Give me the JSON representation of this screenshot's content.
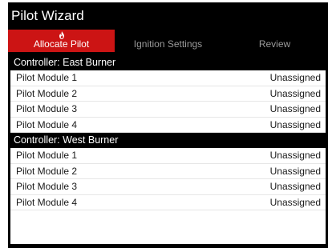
{
  "window": {
    "title": "Pilot Wizard"
  },
  "tabs": [
    {
      "label": "Allocate Pilot",
      "icon": "flame-icon",
      "active": true
    },
    {
      "label": "Ignition Settings",
      "active": false
    },
    {
      "label": "Review",
      "active": false
    }
  ],
  "colors": {
    "accent": "#cc1414",
    "background": "#000000",
    "inactive_tab_text": "#9a9a9a"
  },
  "controllers": [
    {
      "header": "Controller: East Burner",
      "modules": [
        {
          "name": "Pilot Module 1",
          "status": "Unassigned"
        },
        {
          "name": "Pilot Module 2",
          "status": "Unassigned"
        },
        {
          "name": "Pilot Module 3",
          "status": "Unassigned"
        },
        {
          "name": "Pilot Module 4",
          "status": "Unassigned"
        }
      ]
    },
    {
      "header": "Controller: West Burner",
      "modules": [
        {
          "name": "Pilot Module 1",
          "status": "Unassigned"
        },
        {
          "name": "Pilot Module 2",
          "status": "Unassigned"
        },
        {
          "name": "Pilot Module 3",
          "status": "Unassigned"
        },
        {
          "name": "Pilot Module 4",
          "status": "Unassigned"
        }
      ]
    }
  ]
}
